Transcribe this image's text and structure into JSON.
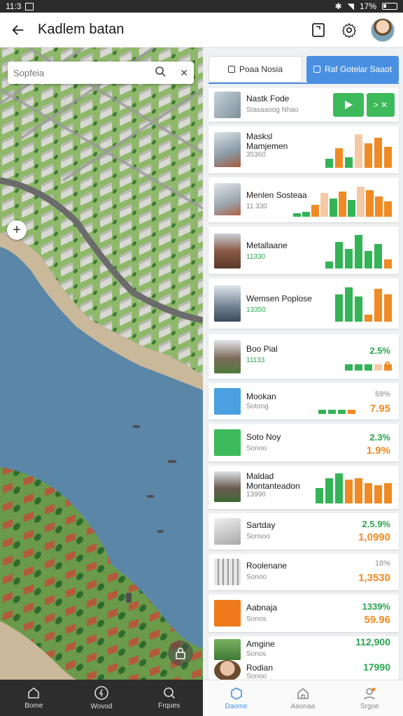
{
  "status_bar": {
    "time": "11:3",
    "battery": "17%"
  },
  "app_bar": {
    "title": "Kadlem batan"
  },
  "map": {
    "search_placeholder": "Sopfeia"
  },
  "tabs": [
    {
      "label": "Poaa Nosia",
      "active": false
    },
    {
      "label": "Raf Gotelar Saaot",
      "active": true
    }
  ],
  "items": [
    {
      "name": "Nastk Fode",
      "sub": "Stasaaoog Nhao"
    },
    {
      "name": "Masksl Mamjemen",
      "sub": "35360",
      "chart": [
        [
          0.25,
          "g"
        ],
        [
          0.55,
          "o"
        ],
        [
          0.3,
          "g"
        ],
        [
          0.95,
          "p"
        ],
        [
          0.7,
          "o"
        ],
        [
          0.85,
          "o"
        ],
        [
          0.6,
          "o"
        ]
      ]
    },
    {
      "name": "Menlen Sosteaa",
      "sub": "11 330",
      "chart": [
        [
          0.1,
          "g"
        ],
        [
          0.15,
          "g"
        ],
        [
          0.35,
          "o"
        ],
        [
          0.7,
          "p"
        ],
        [
          0.55,
          "g"
        ],
        [
          0.75,
          "o"
        ],
        [
          0.5,
          "g"
        ],
        [
          0.9,
          "p"
        ],
        [
          0.8,
          "o"
        ],
        [
          0.6,
          "o"
        ],
        [
          0.45,
          "o"
        ]
      ]
    },
    {
      "name": "Metallaane",
      "sub": "11330",
      "chart": [
        [
          0.2,
          "g"
        ],
        [
          0.75,
          "g"
        ],
        [
          0.55,
          "g"
        ],
        [
          0.95,
          "g"
        ],
        [
          0.5,
          "g"
        ],
        [
          0.7,
          "g"
        ],
        [
          0.25,
          "o"
        ]
      ]
    },
    {
      "name": "Wemsen Poplose",
      "sub": "13350",
      "chart": [
        [
          0.75,
          "g"
        ],
        [
          0.95,
          "g"
        ],
        [
          0.7,
          "g"
        ],
        [
          0.2,
          "o"
        ],
        [
          0.9,
          "o"
        ],
        [
          0.75,
          "o"
        ]
      ]
    },
    {
      "name": "Boo Pial",
      "sub": "11133",
      "stat1": "2.5%",
      "stat2": "0",
      "chart": [
        [
          0.5,
          "g"
        ],
        [
          0.5,
          "g"
        ],
        [
          0.5,
          "g"
        ],
        [
          0.5,
          "p"
        ],
        [
          0.5,
          "o"
        ]
      ]
    },
    {
      "name": "Mookan",
      "sub": "Sotong",
      "stat1": "59%",
      "stat2": "7.95",
      "chart": [
        [
          0.5,
          "g"
        ],
        [
          0.5,
          "g"
        ],
        [
          0.5,
          "g"
        ],
        [
          0.5,
          "o"
        ]
      ]
    },
    {
      "name": "Soto Noy",
      "sub": "Sonoo",
      "stat1": "2.3%",
      "stat2": "1.9%"
    },
    {
      "name": "Maldad Montanteadon",
      "sub": "13990",
      "chart": [
        [
          0.45,
          "g"
        ],
        [
          0.75,
          "g"
        ],
        [
          0.9,
          "g"
        ],
        [
          0.7,
          "o"
        ],
        [
          0.75,
          "o"
        ],
        [
          0.6,
          "o"
        ],
        [
          0.55,
          "o"
        ],
        [
          0.6,
          "o"
        ]
      ]
    },
    {
      "name": "Sartday",
      "sub": "Sonsoo",
      "stat1": "2.5.9%",
      "stat2": "1,0990"
    },
    {
      "name": "Roolenane",
      "sub": "Sonoo",
      "stat1": "10%",
      "stat2": "1,3530"
    },
    {
      "name": "Aabnaja",
      "sub": "Sonos",
      "stat1": "1339%",
      "stat2": "59.96"
    },
    {
      "name": "Amgine",
      "sub": "Sonos",
      "stat1": "112,900"
    },
    {
      "name": "Rodian",
      "sub": "Sonoo",
      "stat1": "17990"
    }
  ],
  "nav_left": [
    "Bome",
    "Wovod",
    "Frques"
  ],
  "nav_right": [
    {
      "label": "Daome",
      "active": true
    },
    {
      "label": "Aaonaa",
      "active": false
    },
    {
      "label": "Srgoe",
      "active": false
    }
  ]
}
